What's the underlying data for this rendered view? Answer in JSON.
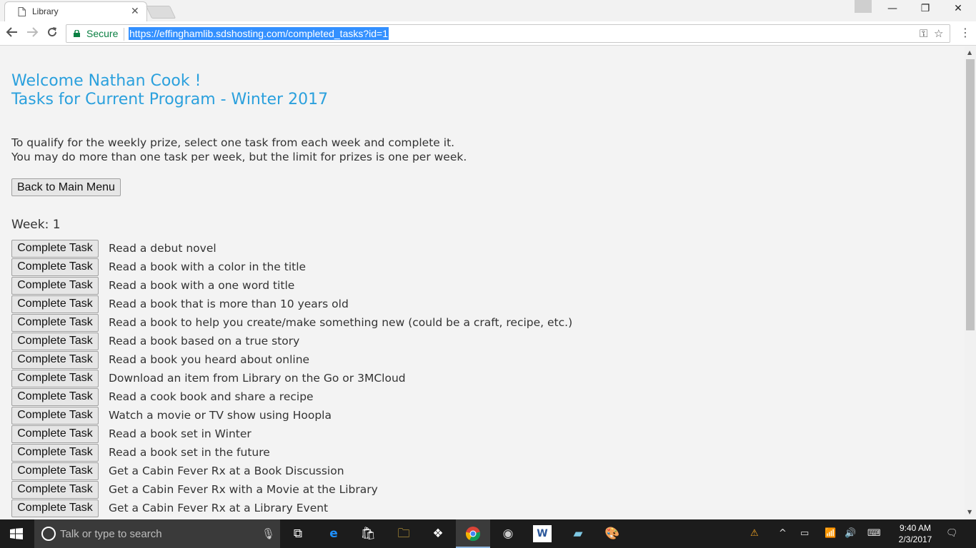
{
  "browser": {
    "tab_title": "Library",
    "tab_close": "✕",
    "window_buttons": [
      "—",
      "❐",
      "✕"
    ],
    "back_icon": "arrow-left-icon",
    "forward_icon": "arrow-right-icon",
    "reload_icon": "reload-icon",
    "security_label": "Secure",
    "url": "https://effinghamlib.sdshosting.com/completed_tasks?id=1",
    "star_icon": "star-icon",
    "menu_icon": "more-vert-icon"
  },
  "page": {
    "welcome": "Welcome Nathan Cook !",
    "program": "Tasks for Current Program - Winter 2017",
    "intro_line1": "To qualify for the weekly prize, select one task from each week and complete it.",
    "intro_line2": "You may do more than one task per week, but the limit for prizes is one per week.",
    "back_button": "Back to Main Menu",
    "week_label": "Week: 1",
    "complete_button": "Complete Task",
    "tasks": [
      "Read a debut novel",
      "Read a book with a color in the title",
      "Read a book with a one word title",
      "Read a book that is more than 10 years old",
      "Read a book to help you create/make something new (could be a craft, recipe, etc.)",
      "Read a book based on a true story",
      "Read a book you heard about online",
      "Download an item from Library on the Go or 3MCloud",
      "Read a cook book and share a recipe",
      "Watch a movie or TV show using Hoopla",
      "Read a book set in Winter",
      "Read a book set in the future",
      "Get a Cabin Fever Rx at a Book Discussion",
      "Get a Cabin Fever Rx with a Movie at the Library",
      "Get a Cabin Fever Rx at a Library Event"
    ]
  },
  "taskbar": {
    "search_placeholder": "Talk or type to search",
    "time": "9:40 AM",
    "date": "2/3/2017",
    "colors": {
      "accent": "#2aa0dd",
      "taskbar": "#1c1c1c"
    }
  }
}
